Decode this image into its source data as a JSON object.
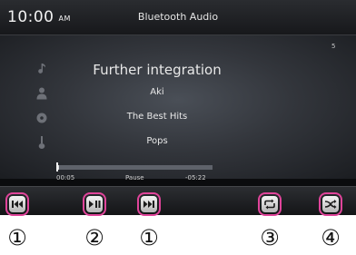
{
  "status": {
    "time": "10:00",
    "ampm": "AM",
    "source": "Bluetooth Audio"
  },
  "track": {
    "number": "5",
    "title": "Further integration",
    "artist": "Aki",
    "album": "The Best Hits",
    "genre": "Pops"
  },
  "playback": {
    "elapsed": "00:05",
    "state": "Pause",
    "remaining": "-05:22",
    "progress_fraction": 0.02
  },
  "controls": [
    {
      "name": "previous-track",
      "icon": "previous-track-icon",
      "callout": "①"
    },
    {
      "name": "play-pause",
      "icon": "play-pause-icon",
      "callout": "②"
    },
    {
      "name": "next-track",
      "icon": "next-track-icon",
      "callout": "①"
    },
    {
      "name": "repeat",
      "icon": "repeat-icon",
      "callout": "③"
    },
    {
      "name": "shuffle",
      "icon": "shuffle-icon",
      "callout": "④"
    }
  ],
  "colors": {
    "highlight": "#e0449a",
    "screen_bg": "#0b0c0e"
  }
}
